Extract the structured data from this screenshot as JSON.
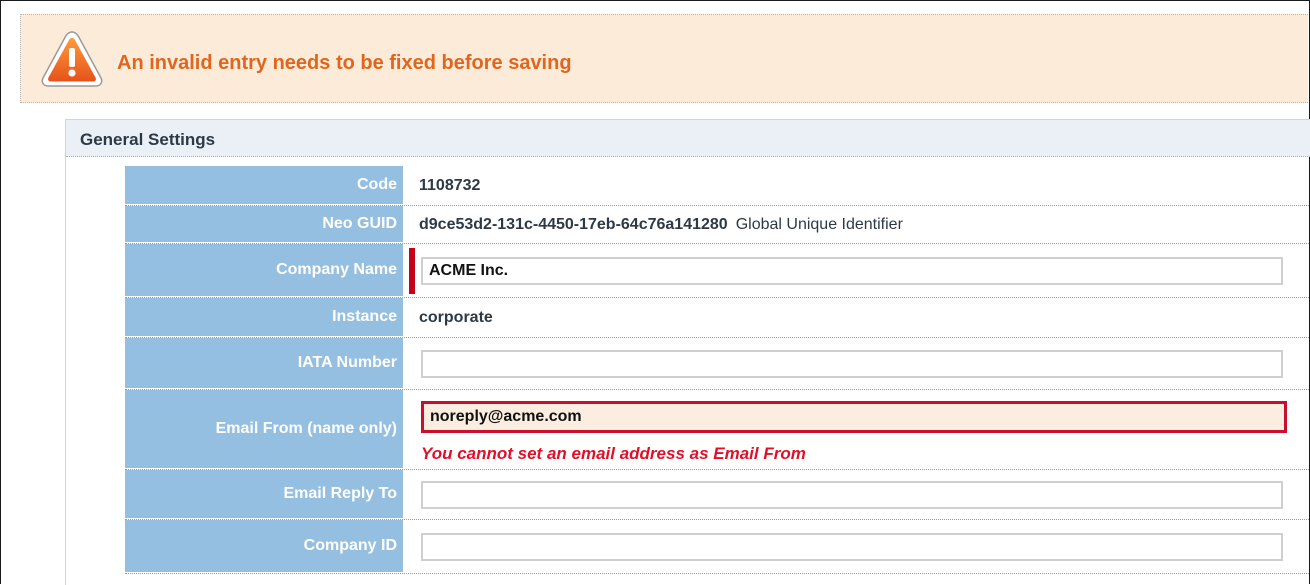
{
  "alert": {
    "icon": "warning-triangle-icon",
    "message": "An invalid entry needs to be fixed before saving",
    "color": "#e0661e",
    "background": "#fcebd9"
  },
  "panel": {
    "title": "General Settings"
  },
  "fields": {
    "code": {
      "label": "Code",
      "value": "1108732"
    },
    "neo_guid": {
      "label": "Neo GUID",
      "value": "d9ce53d2-131c-4450-17eb-64c76a141280",
      "hint": "Global Unique Identifier"
    },
    "company_name": {
      "label": "Company Name",
      "value": "ACME Inc.",
      "required": true
    },
    "instance": {
      "label": "Instance",
      "value": "corporate"
    },
    "iata_number": {
      "label": "IATA Number",
      "value": ""
    },
    "email_from": {
      "label": "Email From (name only)",
      "value": "noreply@acme.com",
      "error": "You cannot set an email address as Email From"
    },
    "email_reply_to": {
      "label": "Email Reply To",
      "value": ""
    },
    "company_id": {
      "label": "Company ID",
      "value": ""
    }
  },
  "colors": {
    "label_background": "#95bfe0",
    "error": "#c8102e",
    "required_marker": "#c4001a"
  }
}
